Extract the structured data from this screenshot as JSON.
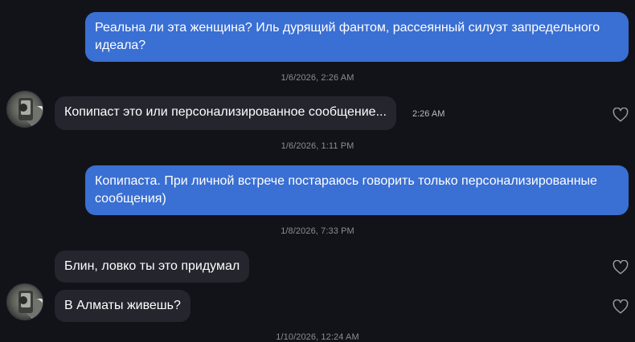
{
  "messages": {
    "m1": {
      "text": "Реальна ли эта женщина? Иль дурящий фантом, рассеянный силуэт запредельного идеала?"
    },
    "m2": {
      "text": "Копипаст это или персонализированное сообщение...",
      "time": "2:26 AM"
    },
    "m3": {
      "text": "Копипаста. При личной встрече постараюсь говорить только персонализированные сообщения)"
    },
    "m4": {
      "text": "Блин, ловко ты это придумал"
    },
    "m5": {
      "text": "В Алматы живешь?"
    }
  },
  "timestamps": {
    "t1": "1/6/2026, 2:26 AM",
    "t2": "1/6/2026, 1:11 PM",
    "t3": "1/8/2026, 7:33 PM",
    "t4": "1/10/2026, 12:24 AM"
  },
  "colors": {
    "background": "#121319",
    "outgoing_bubble": "#3a6fd3",
    "incoming_bubble": "#24252d",
    "timestamp_text": "#8a8d96"
  },
  "icons": {
    "like": "heart-outline-icon",
    "avatar": "user-avatar"
  }
}
